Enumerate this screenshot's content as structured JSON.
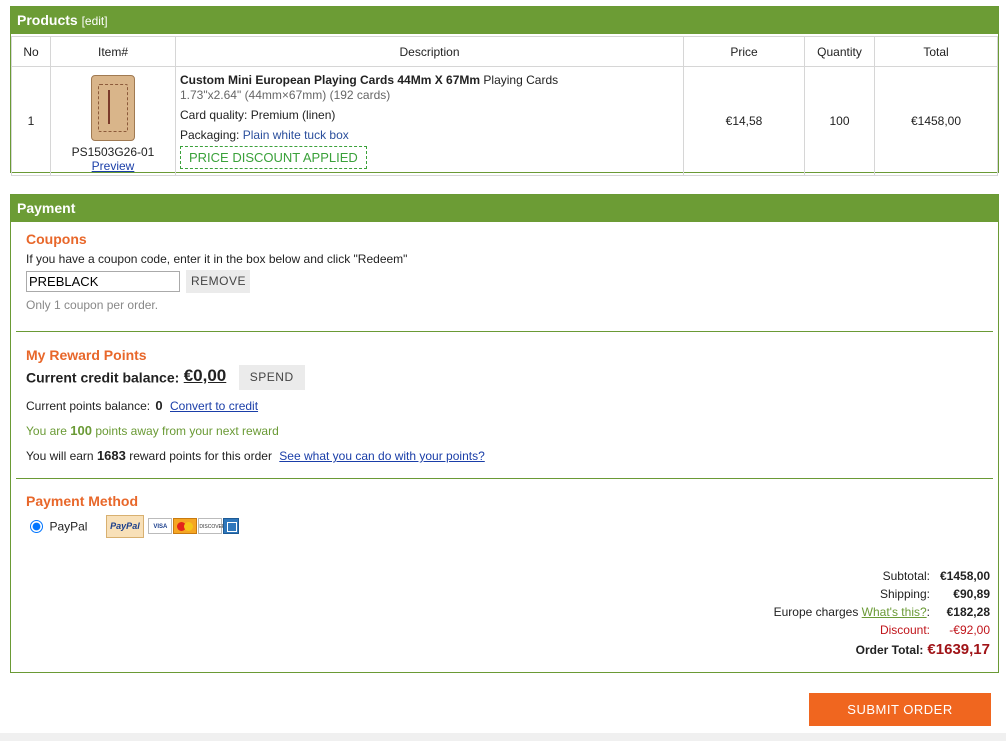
{
  "products": {
    "title": "Products",
    "edit_label": "[edit]",
    "columns": [
      "No",
      "Item#",
      "Description",
      "Price",
      "Quantity",
      "Total"
    ],
    "row": {
      "no": "1",
      "sku": "PS1503G26-01",
      "preview_label": "Preview",
      "title_bold": "Custom Mini European Playing Cards 44Mm X 67Mm",
      "title_rest": " Playing Cards",
      "dimensions": "1.73\"x2.64\" (44mm×67mm) (192 cards)",
      "quality_label": "Card quality:",
      "quality_value": "Premium (linen)",
      "packaging_label": "Packaging:",
      "packaging_value": "Plain white tuck box",
      "discount_badge": "PRICE DISCOUNT APPLIED",
      "price": "€14,58",
      "quantity": "100",
      "total": "€1458,00"
    }
  },
  "payment": {
    "title": "Payment",
    "coupons": {
      "title": "Coupons",
      "instructions": "If you have a coupon code, enter it in the box below and click \"Redeem\"",
      "code_value": "PREBLACK",
      "remove_label": "REMOVE",
      "note": "Only 1 coupon per order."
    },
    "rewards": {
      "title": "My Reward Points",
      "credit_label": "Current credit balance:",
      "credit_value": "€0,00",
      "spend_label": "SPEND",
      "points_label": "Current points balance:",
      "points_value": "0",
      "convert_label": "Convert to credit",
      "away_prefix": "You are",
      "away_value": "100",
      "away_suffix": "points away from your next reward",
      "earn_prefix": "You will earn",
      "earn_value": "1683",
      "earn_suffix": "reward points for this order",
      "see_label": "See what you can do with your points?"
    },
    "method": {
      "title": "Payment Method",
      "option_label": "PayPal",
      "paypal_logo_text": "PayPal",
      "cards": [
        "VISA",
        "MasterCard",
        "DISCOVER",
        "AMEX"
      ]
    },
    "totals": {
      "subtotal_label": "Subtotal:",
      "subtotal_value": "€1458,00",
      "shipping_label": "Shipping:",
      "shipping_value": "€90,89",
      "europe_label": "Europe charges",
      "europe_link": "What's this?",
      "europe_colon": ":",
      "europe_value": "€182,28",
      "discount_label": "Discount:",
      "discount_value": "-€92,00",
      "order_total_label": "Order Total:",
      "order_total_value": "€1639,17"
    }
  },
  "submit_label": "SUBMIT ORDER",
  "colors": {
    "panel_green": "#6c9c35",
    "accent_orange": "#f0661f",
    "discount_green": "#3aa13a",
    "discount_red": "#c0141a"
  }
}
